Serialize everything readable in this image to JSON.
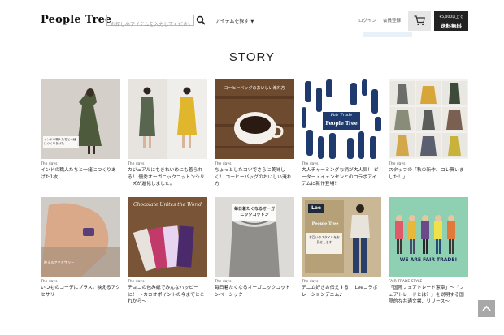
{
  "header": {
    "logo": "People Tree",
    "search_placeholder": "お探しのアイテムを入力してください",
    "category_label": "アイテムを探す",
    "login_label": "ログイン",
    "register_label": "会員登録",
    "shipping_line1": "¥5,000以上で",
    "shipping_line2": "送料無料"
  },
  "page_title": "STORY",
  "cards": [
    {
      "tag": "The days",
      "caption": "インドの職人たちと一緒につくりあげた1枚"
    },
    {
      "tag": "The days",
      "caption": "カジュアルにもきれいめにも着られる！ 優秀オーガニックコットンシリーズが進化しました。"
    },
    {
      "tag": "The days",
      "caption": "ちょっとしたコツでさらに美味しく！ コーヒーバッグのおいしい淹れ方"
    },
    {
      "tag": "The days",
      "caption": "大人チャーミングな柄が大人気！ ピーター・イェンセンとのコラボアイテムに新作登場！"
    },
    {
      "tag": "The days",
      "caption": "スタッフの「秋の新作、コレ買いました！」"
    },
    {
      "tag": "The days",
      "caption": "いつものコーデにプラス。映えるアクセサリー"
    },
    {
      "tag": "The days",
      "caption": "チョコの包み紙でみんなハッピーに！ ～カカオポイントの今までとこれから～"
    },
    {
      "tag": "The days",
      "caption": "毎日着たくなるオーガニックコットンベーシック"
    },
    {
      "tag": "The days",
      "caption": "デニム好きお伝えする！ Leeコラボレーションデニム♪"
    },
    {
      "tag": "FAIR TRADE STYLE",
      "caption": "「国際フェアトレード憲章」～「フェアトレードとは？」を説明する国際的な共通文書、リリース～"
    }
  ],
  "image_overlays": {
    "card1": "インドの職人たちと一緒につくりあげた",
    "card3": "コーヒーバッグのおいしい淹れ方",
    "card4_title": "Fair Trade",
    "card4_logo": "People Tree",
    "card6": "映えるアクセサリー",
    "card7": "Chocolate Unites the World",
    "card8_banner": "毎日着たくなるオーガニックコットン",
    "card9_logo1": "Lee",
    "card9_logo2": "People Tree",
    "card9_text": "お互いのスタイルをお見せします",
    "card10": "WE ARE FAIR TRADE!"
  },
  "colors": {
    "header_border": "#eeeeee",
    "badge_bg": "#222222",
    "cart_bg": "#e6e6e6",
    "fair_trade_bg": "#8fd0b2"
  }
}
